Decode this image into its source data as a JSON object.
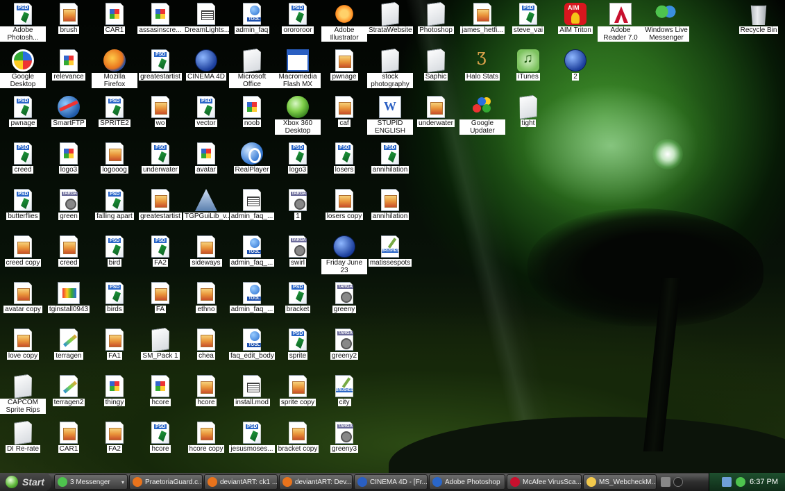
{
  "desktop": {
    "icons": [
      {
        "label": "Adobe Photosh...",
        "type": "psd",
        "icon": "photoshop-icon"
      },
      {
        "label": "brush",
        "type": "img",
        "icon": "image-file-icon"
      },
      {
        "label": "CAR1",
        "type": "paint",
        "icon": "image-file-icon"
      },
      {
        "label": "assasinscre...",
        "type": "paint",
        "icon": "image-file-icon"
      },
      {
        "label": "DreamLights...",
        "type": "txt",
        "icon": "text-file-icon"
      },
      {
        "label": "admin_faq",
        "type": "tool",
        "icon": "tool-file-icon"
      },
      {
        "label": "orororoor",
        "type": "psd",
        "icon": "psd-file-icon"
      },
      {
        "label": "Adobe Illustrator CS2",
        "type": "ai",
        "icon": "illustrator-icon"
      },
      {
        "label": "StrataWebsite",
        "type": "blank",
        "icon": "blank-file-icon"
      },
      {
        "label": "Photoshop",
        "type": "blank",
        "icon": "blank-file-icon"
      },
      {
        "label": "james_hetfi...",
        "type": "img",
        "icon": "image-file-icon"
      },
      {
        "label": "steve_vai",
        "type": "psd",
        "icon": "psd-file-icon"
      },
      {
        "label": "AIM Triton",
        "type": "aim",
        "icon": "aim-icon"
      },
      {
        "label": "Adobe Reader 7.0",
        "type": "adobe",
        "icon": "adobe-reader-icon"
      },
      {
        "label": "Windows Live Messenger",
        "type": "msn",
        "icon": "messenger-icon"
      },
      {
        "label": "Recycle Bin",
        "type": "bin",
        "icon": "recycle-bin-icon"
      },
      {
        "label": "Google Desktop",
        "type": "gdesk",
        "icon": "google-desktop-icon"
      },
      {
        "label": "relevance",
        "type": "paint",
        "icon": "image-file-icon"
      },
      {
        "label": "Mozilla Firefox",
        "type": "firefox",
        "icon": "firefox-icon"
      },
      {
        "label": "greatestartist",
        "type": "psd",
        "icon": "psd-file-icon"
      },
      {
        "label": "CINEMA 4D",
        "type": "globe",
        "icon": "cinema4d-icon"
      },
      {
        "label": "Microsoft Office",
        "type": "blank",
        "icon": "blank-file-icon"
      },
      {
        "label": "Macromedia Flash MX",
        "type": "flash",
        "icon": "flash-icon"
      },
      {
        "label": "pwnage",
        "type": "img",
        "icon": "image-file-icon"
      },
      {
        "label": "stock photography",
        "type": "blank",
        "icon": "blank-file-icon"
      },
      {
        "label": "Saphic",
        "type": "blank",
        "icon": "blank-file-icon"
      },
      {
        "label": "Halo Stats",
        "type": "halo",
        "icon": "halo-icon"
      },
      {
        "label": "iTunes",
        "type": "itunes",
        "icon": "itunes-icon"
      },
      {
        "label": "2",
        "type": "globe",
        "icon": "cinema4d-file-icon"
      },
      {
        "label": "pwnage",
        "type": "psd",
        "icon": "psd-file-icon"
      },
      {
        "label": "SmartFTP",
        "type": "ftp",
        "icon": "smartftp-icon"
      },
      {
        "label": "SPRITE2",
        "type": "psd",
        "icon": "psd-file-icon"
      },
      {
        "label": "wo",
        "type": "img",
        "icon": "image-file-icon"
      },
      {
        "label": "vector",
        "type": "psd",
        "icon": "psd-file-icon"
      },
      {
        "label": "noob",
        "type": "paint",
        "icon": "image-file-icon"
      },
      {
        "label": "Xbox 360 Desktop",
        "type": "xbox",
        "icon": "xbox-icon"
      },
      {
        "label": "caf",
        "type": "img",
        "icon": "image-file-icon"
      },
      {
        "label": "STUPID ENGLISH",
        "type": "word",
        "icon": "word-document-icon"
      },
      {
        "label": "underwater",
        "type": "img",
        "icon": "image-file-icon"
      },
      {
        "label": "Google Updater",
        "type": "gupd",
        "icon": "google-updater-icon"
      },
      {
        "label": "tight",
        "type": "blank",
        "icon": "blank-file-icon"
      },
      {
        "label": "creed",
        "type": "psd",
        "icon": "psd-file-icon"
      },
      {
        "label": "logo3",
        "type": "paint",
        "icon": "image-file-icon"
      },
      {
        "label": "logooog",
        "type": "img",
        "icon": "image-file-icon"
      },
      {
        "label": "underwater",
        "type": "psd",
        "icon": "psd-file-icon"
      },
      {
        "label": "avatar",
        "type": "paint",
        "icon": "image-file-icon"
      },
      {
        "label": "RealPlayer",
        "type": "real",
        "icon": "realplayer-icon"
      },
      {
        "label": "logo3",
        "type": "psd",
        "icon": "psd-file-icon"
      },
      {
        "label": "losers",
        "type": "psd",
        "icon": "psd-file-icon"
      },
      {
        "label": "annihilation",
        "type": "psd",
        "icon": "psd-file-icon"
      },
      {
        "label": "butterflies",
        "type": "psd",
        "icon": "psd-file-icon"
      },
      {
        "label": "green",
        "type": "targa",
        "icon": "targa-file-icon"
      },
      {
        "label": "falling apart",
        "type": "psd",
        "icon": "psd-file-icon"
      },
      {
        "label": "greatestartist",
        "type": "img",
        "icon": "image-file-icon"
      },
      {
        "label": "TGPGuiLib_v...",
        "type": "tgp",
        "icon": "tgp-icon"
      },
      {
        "label": "admin_faq_...",
        "type": "txt",
        "icon": "text-file-icon"
      },
      {
        "label": "1",
        "type": "targa",
        "icon": "targa-file-icon"
      },
      {
        "label": "losers copy",
        "type": "img",
        "icon": "image-file-icon"
      },
      {
        "label": "annihilation",
        "type": "img",
        "icon": "image-file-icon"
      },
      {
        "label": "creed copy",
        "type": "img",
        "icon": "image-file-icon"
      },
      {
        "label": "creed",
        "type": "img",
        "icon": "image-file-icon"
      },
      {
        "label": "bird",
        "type": "psd",
        "icon": "psd-file-icon"
      },
      {
        "label": "FA2",
        "type": "psd",
        "icon": "psd-file-icon"
      },
      {
        "label": "sideways",
        "type": "img",
        "icon": "image-file-icon"
      },
      {
        "label": "admin_faq_...",
        "type": "tool",
        "icon": "tool-file-icon"
      },
      {
        "label": "swirl",
        "type": "targa",
        "icon": "targa-file-icon"
      },
      {
        "label": "Friday June 23",
        "type": "globe",
        "icon": "cinema4d-file-icon"
      },
      {
        "label": "matissespots",
        "type": "brush",
        "icon": "brushes-file-icon"
      },
      {
        "label": "avatar copy",
        "type": "img",
        "icon": "image-file-icon"
      },
      {
        "label": "tginstall0943",
        "type": "setup",
        "icon": "installer-icon"
      },
      {
        "label": "birds",
        "type": "psd",
        "icon": "psd-file-icon"
      },
      {
        "label": "FA",
        "type": "img",
        "icon": "image-file-icon"
      },
      {
        "label": "ethno",
        "type": "img",
        "icon": "image-file-icon"
      },
      {
        "label": "admin_faq_...",
        "type": "tool",
        "icon": "tool-file-icon"
      },
      {
        "label": "bracket",
        "type": "psd",
        "icon": "psd-file-icon"
      },
      {
        "label": "greeny",
        "type": "targa",
        "icon": "targa-file-icon"
      },
      {
        "label": "love copy",
        "type": "img",
        "icon": "image-file-icon"
      },
      {
        "label": "terragen",
        "type": "terragen",
        "icon": "terragen-file-icon"
      },
      {
        "label": "FA1",
        "type": "img",
        "icon": "image-file-icon"
      },
      {
        "label": "SM_Pack 1",
        "type": "blank",
        "icon": "blank-file-icon"
      },
      {
        "label": "chea",
        "type": "img",
        "icon": "image-file-icon"
      },
      {
        "label": "faq_edit_body",
        "type": "tool",
        "icon": "tool-file-icon"
      },
      {
        "label": "sprite",
        "type": "psd",
        "icon": "psd-file-icon"
      },
      {
        "label": "greeny2",
        "type": "targa",
        "icon": "targa-file-icon"
      },
      {
        "label": "CAPCOM Sprite Rips",
        "type": "blank",
        "icon": "blank-file-icon"
      },
      {
        "label": "terragen2",
        "type": "terragen",
        "icon": "terragen-file-icon"
      },
      {
        "label": "thingy",
        "type": "paint",
        "icon": "image-file-icon"
      },
      {
        "label": "hcore",
        "type": "paint",
        "icon": "image-file-icon"
      },
      {
        "label": "hcore",
        "type": "img",
        "icon": "image-file-icon"
      },
      {
        "label": "install.mod",
        "type": "txt",
        "icon": "text-file-icon"
      },
      {
        "label": "sprite copy",
        "type": "img",
        "icon": "image-file-icon"
      },
      {
        "label": "city",
        "type": "brush",
        "icon": "brushes-file-icon"
      },
      {
        "label": "DI Re-rate",
        "type": "blank",
        "icon": "blank-file-icon"
      },
      {
        "label": "CAR1",
        "type": "img",
        "icon": "image-file-icon"
      },
      {
        "label": "FA2",
        "type": "img",
        "icon": "image-file-icon"
      },
      {
        "label": "hcore",
        "type": "psd",
        "icon": "psd-file-icon"
      },
      {
        "label": "hcore copy",
        "type": "img",
        "icon": "image-file-icon"
      },
      {
        "label": "jesusmoses...",
        "type": "psd",
        "icon": "psd-file-icon"
      },
      {
        "label": "bracket copy",
        "type": "img",
        "icon": "image-file-icon"
      },
      {
        "label": "greeny3",
        "type": "targa",
        "icon": "targa-file-icon"
      }
    ]
  },
  "taskbar": {
    "start_label": "Start",
    "tasks": [
      {
        "label": "3 Messenger",
        "icon": "messenger-icon",
        "color": "#4ec34e",
        "grouped": true
      },
      {
        "label": "PraetoriaGuard.c...",
        "icon": "firefox-icon",
        "color": "#e8731c"
      },
      {
        "label": "deviantART: ck1 ...",
        "icon": "firefox-icon",
        "color": "#e8731c"
      },
      {
        "label": "deviantART: Dev...",
        "icon": "firefox-icon",
        "color": "#e8731c"
      },
      {
        "label": "CINEMA 4D - [Fr...",
        "icon": "cinema4d-icon",
        "color": "#2a5fc2"
      },
      {
        "label": "Adobe Photoshop",
        "icon": "photoshop-icon",
        "color": "#2a66c8"
      },
      {
        "label": "McAfee VirusSca...",
        "icon": "mcafee-icon",
        "color": "#c8102e"
      },
      {
        "label": "MS_WebcheckM...",
        "icon": "folder-icon",
        "color": "#f2c94c"
      }
    ],
    "clock": "6:37 PM"
  }
}
